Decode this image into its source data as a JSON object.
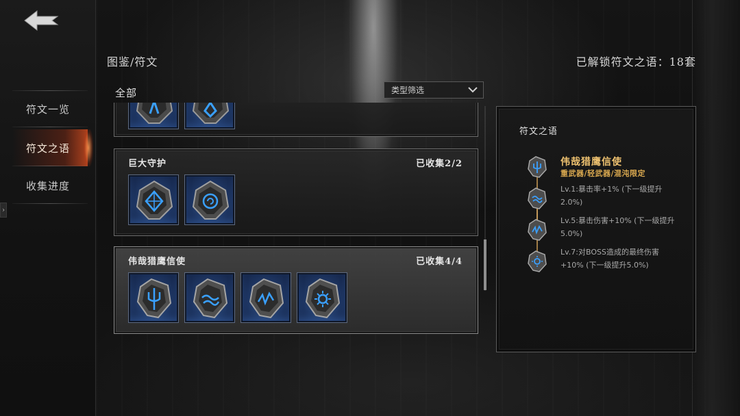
{
  "nav": {
    "back_label": "",
    "items": [
      {
        "label": "符文一览"
      },
      {
        "label": "符文之语"
      },
      {
        "label": "收集进度"
      }
    ]
  },
  "header": {
    "breadcrumb": "图鉴/符文",
    "unlock_text": "已解锁符文之语：18套"
  },
  "filter": {
    "category_label": "全部",
    "dropdown_label": "类型筛选"
  },
  "list": {
    "cards": [
      {
        "name": "",
        "count": "",
        "runes": [
          "rune-a-icon",
          "rune-b-icon"
        ]
      },
      {
        "name": "巨大守护",
        "count": "已收集2/2",
        "runes": [
          "rune-diamond-icon",
          "rune-spiral-icon"
        ]
      },
      {
        "name": "伟哉猎鹰信使",
        "count": "已收集4/4",
        "runes": [
          "rune-trident-icon",
          "rune-wave-icon",
          "rune-zigzag-icon",
          "rune-sun-icon"
        ]
      }
    ]
  },
  "detail": {
    "section_title": "符文之语",
    "runeword_name": "伟哉猎鹰信使",
    "restriction": "重武器/轻武器/混沌限定",
    "effects": [
      "Lv.1:暴击率+1% (下一级提升2.0%)",
      "Lv.5:暴击伤害+10% (下一级提升5.0%)",
      "Lv.7:对BOSS造成的最终伤害+10% (下一级提升5.0%)"
    ]
  },
  "colors": {
    "accent_gold": "#efc270",
    "restriction_gold": "#d9a84f",
    "rune_blue": "#3aa0ff",
    "active_nav": "#c0461e"
  }
}
